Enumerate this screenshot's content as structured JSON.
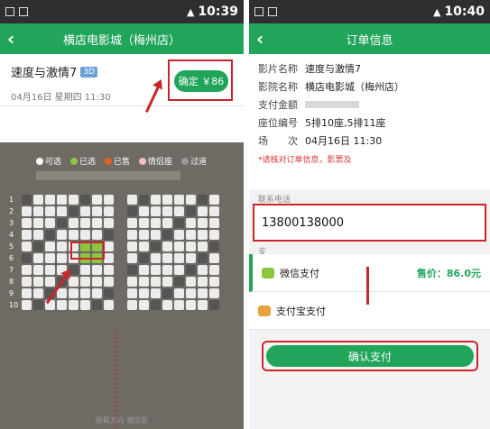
{
  "colors": {
    "brand": "#21a55b",
    "highlight": "#c9262c",
    "statusbar": "#2f2f2f"
  },
  "left": {
    "status": {
      "time": "10:39"
    },
    "title": "横店电影城（梅州店）",
    "movie": {
      "name": "速度与激情7",
      "format": "3D",
      "showtime": "04月16日 星期四 11:30"
    },
    "confirm_label": "确定 ￥86",
    "legend": [
      {
        "label": "可选",
        "color": "#ffffff"
      },
      {
        "label": "已选",
        "color": "#8cc63f"
      },
      {
        "label": "已售",
        "color": "#e06020"
      },
      {
        "label": "情侣座",
        "color": "#f0c0c0"
      },
      {
        "label": "过道",
        "color": "#999999"
      }
    ],
    "row_numbers": [
      "1",
      "2",
      "3",
      "4",
      "5",
      "6",
      "7",
      "8",
      "9",
      "10"
    ],
    "footer": "银幕方向 横店影"
  },
  "right": {
    "status": {
      "time": "10:40"
    },
    "title": "订单信息",
    "rows": [
      {
        "label": "影片名称",
        "value": "速度与激情7"
      },
      {
        "label": "影院名称",
        "value": "横店电影城（梅州店）"
      },
      {
        "label": "支付金额",
        "value": ""
      },
      {
        "label": "座位编号",
        "value": "5排10座,5排11座"
      },
      {
        "label": "场　　次",
        "value": "04月16日 11:30"
      }
    ],
    "notice": "*请核对订单信息，影票及",
    "phone_label": "联系电话",
    "phone_value": "13800138000",
    "pay_section": "支",
    "pay_methods": [
      {
        "label": "微信支付",
        "price": "售价：86.0元"
      },
      {
        "label": "支付宝支付",
        "price": ""
      }
    ],
    "pay_button": "确认支付"
  }
}
